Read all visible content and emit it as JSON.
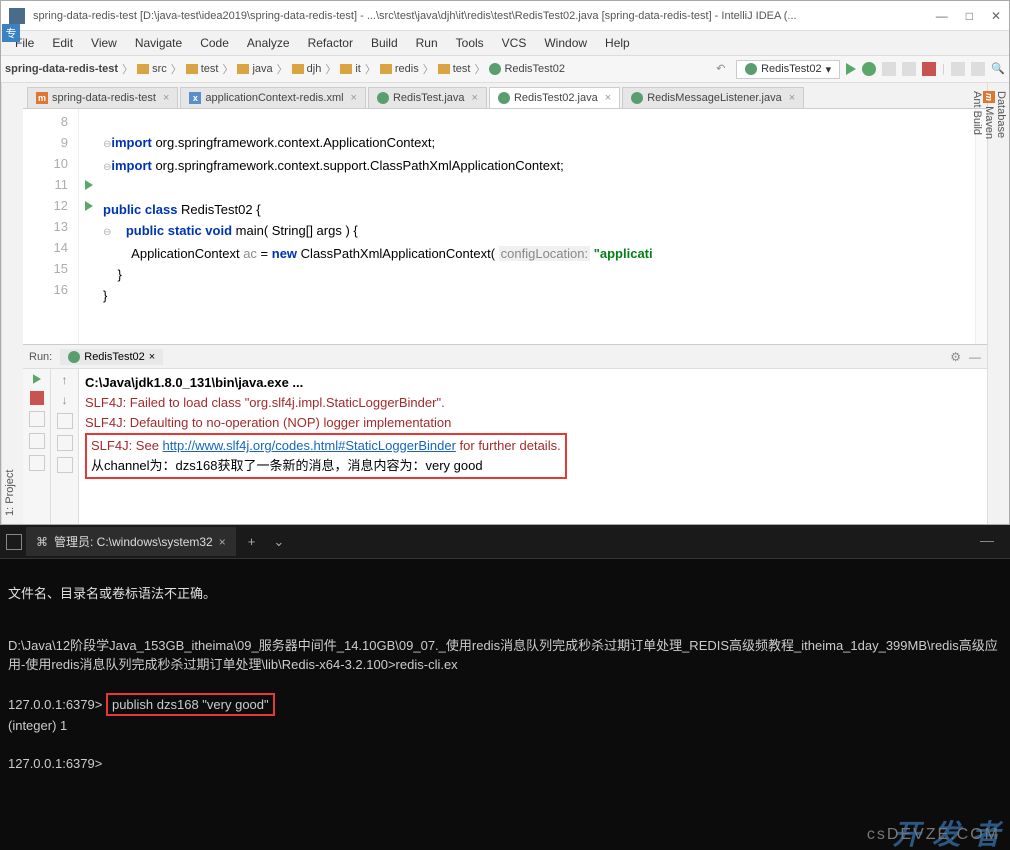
{
  "title": "spring-data-redis-test [D:\\java-test\\idea2019\\spring-data-redis-test] - ...\\src\\test\\java\\djh\\it\\redis\\test\\RedisTest02.java [spring-data-redis-test] - IntelliJ IDEA (...",
  "badge": "专",
  "menu": {
    "file": "File",
    "edit": "Edit",
    "view": "View",
    "navigate": "Navigate",
    "code": "Code",
    "analyze": "Analyze",
    "refactor": "Refactor",
    "build": "Build",
    "run": "Run",
    "tools": "Tools",
    "vcs": "VCS",
    "window": "Window",
    "help": "Help"
  },
  "breadcrumb": [
    "spring-data-redis-test",
    "src",
    "test",
    "java",
    "djh",
    "it",
    "redis",
    "test",
    "RedisTest02"
  ],
  "run_config": "RedisTest02",
  "left_label": "1: Project",
  "right_labels": {
    "db": "Database",
    "maven": "Maven",
    "ant": "Ant Build"
  },
  "tabs": [
    {
      "icon": "m",
      "label": "spring-data-redis-test",
      "active": false
    },
    {
      "icon": "m",
      "label": "applicationContext-redis.xml",
      "active": false
    },
    {
      "icon": "c",
      "label": "RedisTest.java",
      "active": false
    },
    {
      "icon": "c",
      "label": "RedisTest02.java",
      "active": true
    },
    {
      "icon": "c",
      "label": "RedisMessageListener.java",
      "active": false
    }
  ],
  "lines": {
    "8": "8",
    "9": "9",
    "10": "10",
    "11": "11",
    "12": "12",
    "13": "13",
    "14": "14",
    "15": "15",
    "16": "16"
  },
  "code": {
    "l8": "import org.springframework.context.ApplicationContext;",
    "l9": "import org.springframework.context.support.ClassPathXmlApplicationContext;",
    "l10": "",
    "l11a": "public class ",
    "l11b": "RedisTest02 {",
    "l12a": "    public static void ",
    "l12b": "main( String[] args ) {",
    "l13a": "        ApplicationContext ",
    "l13b": "ac",
    "l13c": " = ",
    "l13d": "new ",
    "l13e": "ClassPathXmlApplicationContext( ",
    "l13f": "configLocation:",
    "l13g": " \"applicati",
    "l14": "    }",
    "l15": "}",
    "l16": ""
  },
  "run": {
    "label": "Run:",
    "tab": "RedisTest02",
    "l1": "C:\\Java\\jdk1.8.0_131\\bin\\java.exe ...",
    "l2": "SLF4J: Failed to load class \"org.slf4j.impl.StaticLoggerBinder\".",
    "l3": "SLF4J: Defaulting to no-operation (NOP) logger implementation",
    "l4a": "SLF4J: See ",
    "l4b": "http://www.slf4j.org/codes.html#StaticLoggerBinder",
    "l4c": " for further details.",
    "l5": "从channel为：dzs168获取了一条新的消息，消息内容为：very good"
  },
  "term": {
    "tab": "管理员: C:\\windows\\system32",
    "err": "文件名、目录名或卷标语法不正确。",
    "path": "D:\\Java\\12阶段学Java_153GB_itheima\\09_服务器中间件_14.10GB\\09_07._使用redis消息队列完成秒杀过期订单处理_REDIS高级频教程_itheima_1day_399MB\\redis高级应用-使用redis消息队列完成秒杀过期订单处理\\lib\\Redis-x64-3.2.100>redis-cli.ex",
    "p1": "127.0.0.1:6379>",
    "cmd": "publish dzs168 \"very good\"",
    "res": "(integer) 1",
    "p2": "127.0.0.1:6379>",
    "wm1": "开 发 者",
    "wm2": "csDEVZE.COM"
  }
}
